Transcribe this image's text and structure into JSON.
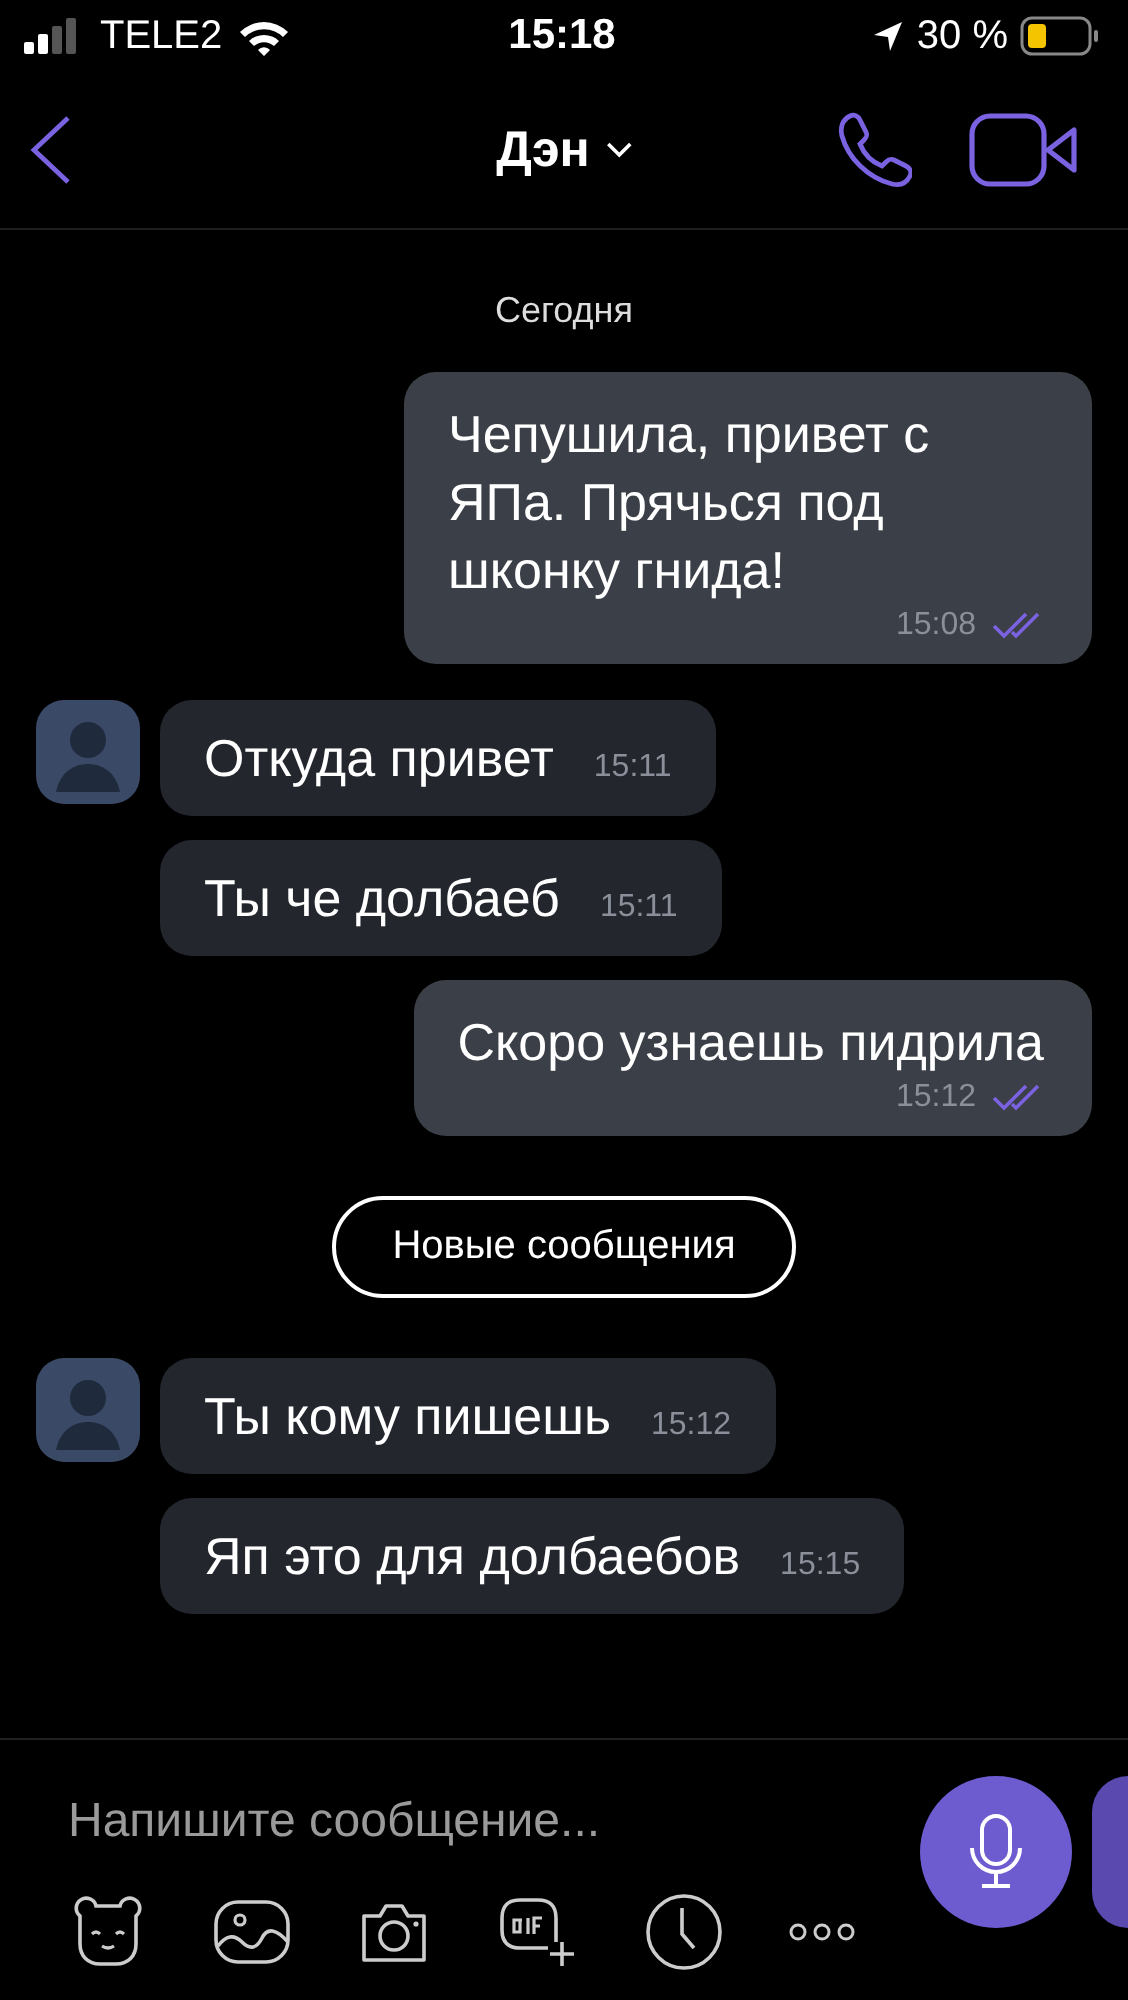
{
  "status_bar": {
    "carrier": "TELE2",
    "time": "15:18",
    "battery": "30 %"
  },
  "header": {
    "title": "Дэн"
  },
  "messages": [
    {
      "kind": "date",
      "text": "Сегодня"
    },
    {
      "kind": "outgoing",
      "text": "Чепушила, привет с ЯПа. Прячься под шконку гнида!",
      "time": "15:08",
      "read": true
    },
    {
      "kind": "incoming",
      "text": "Откуда привет",
      "time": "15:11",
      "avatar": true
    },
    {
      "kind": "incoming",
      "text": "Ты че долбаеб",
      "time": "15:11",
      "avatar": false
    },
    {
      "kind": "outgoing",
      "text": "Скоро узнаешь пидрила",
      "time": "15:12",
      "read": true
    },
    {
      "kind": "new_divider",
      "text": "Новые сообщения"
    },
    {
      "kind": "incoming",
      "text": "Ты кому пишешь",
      "time": "15:12",
      "avatar": true
    },
    {
      "kind": "incoming",
      "text": "Яп это для долбаебов",
      "time": "15:15",
      "avatar": false
    }
  ],
  "composer": {
    "placeholder": "Напишите сообщение..."
  }
}
